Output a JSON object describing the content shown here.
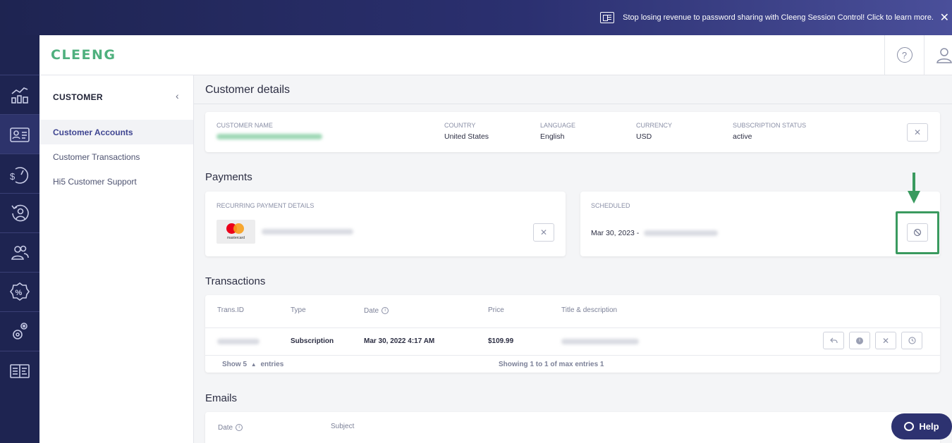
{
  "banner": {
    "text": "Stop losing revenue to password sharing with Cleeng Session Control! Click to learn more.",
    "close": "✕"
  },
  "header": {
    "logo": "CLEENG",
    "help": "?"
  },
  "rail": {
    "items": [
      "analytics-icon",
      "customer-card-icon",
      "revenue-gauge-icon",
      "churn-person-icon",
      "users-icon",
      "discount-percent-icon",
      "settings-gears-icon",
      "documentation-icon"
    ]
  },
  "subnav": {
    "title": "CUSTOMER",
    "collapse": "‹",
    "items": [
      {
        "label": "Customer Accounts",
        "active": true
      },
      {
        "label": "Customer Transactions",
        "active": false
      },
      {
        "label": "Hi5 Customer Support",
        "active": false
      }
    ]
  },
  "page": {
    "title": "Customer details"
  },
  "customer": {
    "name_label": "CUSTOMER NAME",
    "country_label": "COUNTRY",
    "country": "United States",
    "language_label": "LANGUAGE",
    "language": "English",
    "currency_label": "CURRENCY",
    "currency": "USD",
    "status_label": "SUBSCRIPTION STATUS",
    "status": "active"
  },
  "payments": {
    "title": "Payments",
    "recurring_label": "RECURRING PAYMENT DETAILS",
    "card_brand": "mastercard",
    "scheduled_label": "SCHEDULED",
    "scheduled_date": "Mar 30, 2023 -"
  },
  "transactions": {
    "title": "Transactions",
    "headers": {
      "id": "Trans.ID",
      "type": "Type",
      "date": "Date",
      "price": "Price",
      "title": "Title & description"
    },
    "rows": [
      {
        "type": "Subscription",
        "date": "Mar 30, 2022 4:17 AM",
        "price": "$109.99"
      }
    ],
    "show_prefix": "Show 5",
    "show_suffix": "entries",
    "showing": "Showing 1 to 1 of max entries 1"
  },
  "emails": {
    "title": "Emails",
    "headers": {
      "date": "Date",
      "subject": "Subject"
    }
  },
  "help_button": {
    "label": "Help"
  },
  "colors": {
    "brand_green": "#4fb07e",
    "navy": "#1e2451",
    "highlight": "#3a9a5f"
  }
}
